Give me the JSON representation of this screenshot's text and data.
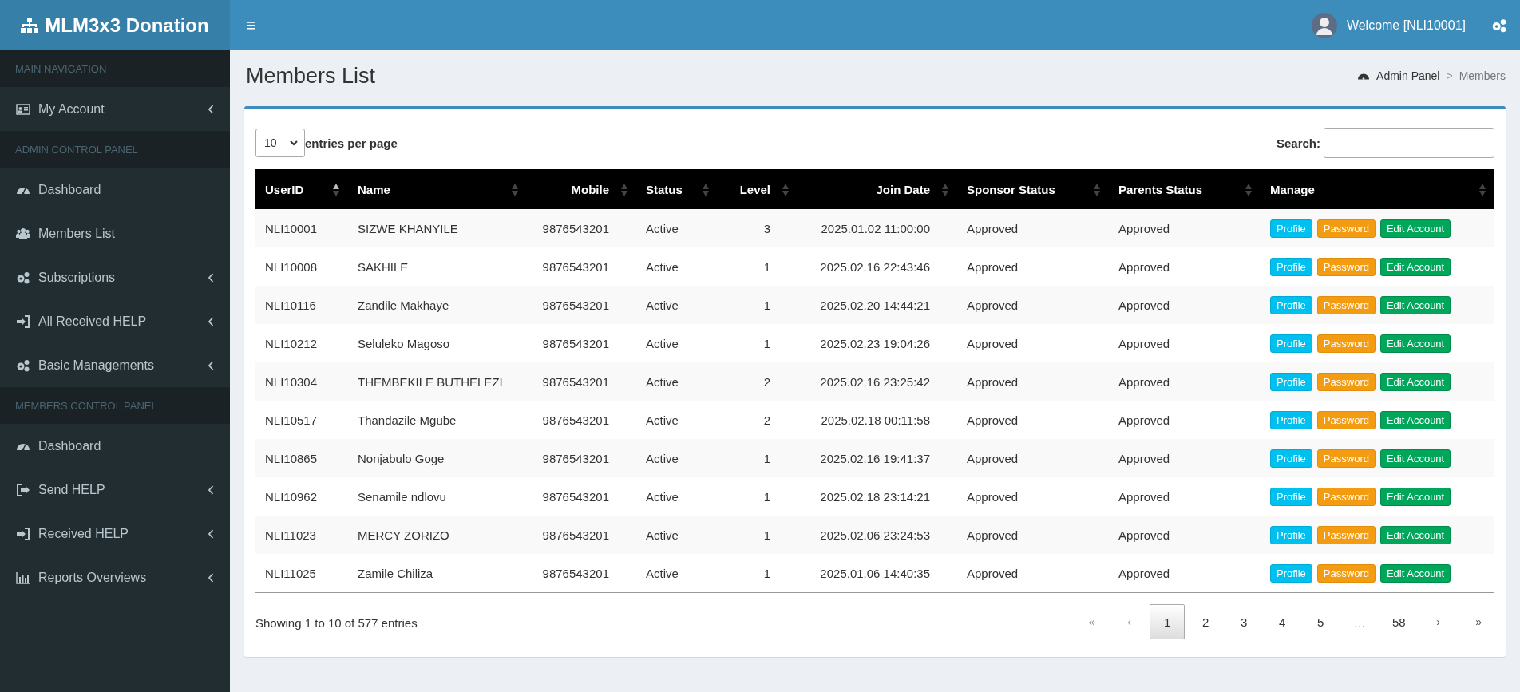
{
  "brand": {
    "title": "MLM3x3 Donation"
  },
  "navbar": {
    "menu_toggle": "≡",
    "welcome": "Welcome [NLI10001]"
  },
  "sidebar": {
    "items": [
      {
        "kind": "heading",
        "label": "MAIN NAVIGATION"
      },
      {
        "kind": "link",
        "label": "My Account",
        "submenu": true
      },
      {
        "kind": "heading",
        "label": "ADMIN CONTROL PANEL"
      },
      {
        "kind": "link",
        "label": "Dashboard",
        "submenu": false
      },
      {
        "kind": "link",
        "label": "Members List",
        "submenu": false
      },
      {
        "kind": "link",
        "label": "Subscriptions",
        "submenu": true
      },
      {
        "kind": "link",
        "label": "All Received HELP",
        "submenu": true
      },
      {
        "kind": "link",
        "label": "Basic Managements",
        "submenu": true
      },
      {
        "kind": "heading",
        "label": "MEMBERS CONTROL PANEL"
      },
      {
        "kind": "link",
        "label": "Dashboard",
        "submenu": false
      },
      {
        "kind": "link",
        "label": "Send HELP",
        "submenu": true
      },
      {
        "kind": "link",
        "label": "Received HELP",
        "submenu": true
      },
      {
        "kind": "link",
        "label": "Reports Overviews",
        "submenu": true
      }
    ]
  },
  "page": {
    "title": "Members List",
    "breadcrumb": [
      "Admin Panel",
      "Members"
    ],
    "breadcrumb_separator": ">"
  },
  "table_controls": {
    "page_size": "10",
    "page_size_label": "entries per page",
    "search_label": "Search:"
  },
  "table": {
    "columns": [
      {
        "label": "UserID",
        "kind": "text",
        "sorted": true
      },
      {
        "label": "Name",
        "kind": "text",
        "sorted": false
      },
      {
        "label": "Mobile",
        "kind": "number",
        "sorted": false
      },
      {
        "label": "Status",
        "kind": "text",
        "sorted": false
      },
      {
        "label": "Level",
        "kind": "number",
        "sorted": false
      },
      {
        "label": "Join Date",
        "kind": "number",
        "sorted": false
      },
      {
        "label": "Sponsor Status",
        "kind": "text",
        "sorted": false
      },
      {
        "label": "Parents Status",
        "kind": "text",
        "sorted": false
      },
      {
        "label": "Manage",
        "kind": "actions",
        "sorted": false
      }
    ],
    "rows": [
      {
        "cells": [
          "NLI10001",
          "SIZWE KHANYILE",
          "9876543201",
          "Active",
          "3",
          "2025.01.02 11:00:00",
          "Approved",
          "Approved"
        ],
        "actions": [
          {
            "label": "Profile",
            "kind": "info"
          },
          {
            "label": "Password",
            "kind": "warning"
          },
          {
            "label": "Edit Account",
            "kind": "success"
          }
        ]
      },
      {
        "cells": [
          "NLI10008",
          "SAKHILE",
          "9876543201",
          "Active",
          "1",
          "2025.02.16 22:43:46",
          "Approved",
          "Approved"
        ],
        "actions": [
          {
            "label": "Profile",
            "kind": "info"
          },
          {
            "label": "Password",
            "kind": "warning"
          },
          {
            "label": "Edit Account",
            "kind": "success"
          }
        ]
      },
      {
        "cells": [
          "NLI10116",
          "Zandile Makhaye",
          "9876543201",
          "Active",
          "1",
          "2025.02.20 14:44:21",
          "Approved",
          "Approved"
        ],
        "actions": [
          {
            "label": "Profile",
            "kind": "info"
          },
          {
            "label": "Password",
            "kind": "warning"
          },
          {
            "label": "Edit Account",
            "kind": "success"
          }
        ]
      },
      {
        "cells": [
          "NLI10212",
          "Seluleko Magoso",
          "9876543201",
          "Active",
          "1",
          "2025.02.23 19:04:26",
          "Approved",
          "Approved"
        ],
        "actions": [
          {
            "label": "Profile",
            "kind": "info"
          },
          {
            "label": "Password",
            "kind": "warning"
          },
          {
            "label": "Edit Account",
            "kind": "success"
          }
        ]
      },
      {
        "cells": [
          "NLI10304",
          "THEMBEKILE BUTHELEZI",
          "9876543201",
          "Active",
          "2",
          "2025.02.16 23:25:42",
          "Approved",
          "Approved"
        ],
        "actions": [
          {
            "label": "Profile",
            "kind": "info"
          },
          {
            "label": "Password",
            "kind": "warning"
          },
          {
            "label": "Edit Account",
            "kind": "success"
          }
        ]
      },
      {
        "cells": [
          "NLI10517",
          "Thandazile Mgube",
          "9876543201",
          "Active",
          "2",
          "2025.02.18 00:11:58",
          "Approved",
          "Approved"
        ],
        "actions": [
          {
            "label": "Profile",
            "kind": "info"
          },
          {
            "label": "Password",
            "kind": "warning"
          },
          {
            "label": "Edit Account",
            "kind": "success"
          }
        ]
      },
      {
        "cells": [
          "NLI10865",
          "Nonjabulo Goge",
          "9876543201",
          "Active",
          "1",
          "2025.02.16 19:41:37",
          "Approved",
          "Approved"
        ],
        "actions": [
          {
            "label": "Profile",
            "kind": "info"
          },
          {
            "label": "Password",
            "kind": "warning"
          },
          {
            "label": "Edit Account",
            "kind": "success"
          }
        ]
      },
      {
        "cells": [
          "NLI10962",
          "Senamile ndlovu",
          "9876543201",
          "Active",
          "1",
          "2025.02.18 23:14:21",
          "Approved",
          "Approved"
        ],
        "actions": [
          {
            "label": "Profile",
            "kind": "info"
          },
          {
            "label": "Password",
            "kind": "warning"
          },
          {
            "label": "Edit Account",
            "kind": "success"
          }
        ]
      },
      {
        "cells": [
          "NLI11023",
          "MERCY ZORIZO",
          "9876543201",
          "Active",
          "1",
          "2025.02.06 23:24:53",
          "Approved",
          "Approved"
        ],
        "actions": [
          {
            "label": "Profile",
            "kind": "info"
          },
          {
            "label": "Password",
            "kind": "warning"
          },
          {
            "label": "Edit Account",
            "kind": "success"
          }
        ]
      },
      {
        "cells": [
          "NLI11025",
          "Zamile Chiliza",
          "9876543201",
          "Active",
          "1",
          "2025.01.06 14:40:35",
          "Approved",
          "Approved"
        ],
        "actions": [
          {
            "label": "Profile",
            "kind": "info"
          },
          {
            "label": "Password",
            "kind": "warning"
          },
          {
            "label": "Edit Account",
            "kind": "success"
          }
        ]
      }
    ]
  },
  "footer": {
    "info": "Showing 1 to 10 of 577 entries",
    "pagination": [
      {
        "label": "«",
        "kind": "nav",
        "selected": false,
        "disabled": true
      },
      {
        "label": "‹",
        "kind": "nav",
        "selected": false,
        "disabled": true
      },
      {
        "label": "1",
        "kind": "page",
        "selected": true,
        "disabled": false
      },
      {
        "label": "2",
        "kind": "page",
        "selected": false,
        "disabled": false
      },
      {
        "label": "3",
        "kind": "page",
        "selected": false,
        "disabled": false
      },
      {
        "label": "4",
        "kind": "page",
        "selected": false,
        "disabled": false
      },
      {
        "label": "5",
        "kind": "page",
        "selected": false,
        "disabled": false
      },
      {
        "label": "…",
        "kind": "ellipsis",
        "selected": false,
        "disabled": false
      },
      {
        "label": "58",
        "kind": "page",
        "selected": false,
        "disabled": false
      },
      {
        "label": "›",
        "kind": "nav",
        "selected": false,
        "disabled": false
      },
      {
        "label": "»",
        "kind": "nav",
        "selected": false,
        "disabled": false
      }
    ]
  }
}
